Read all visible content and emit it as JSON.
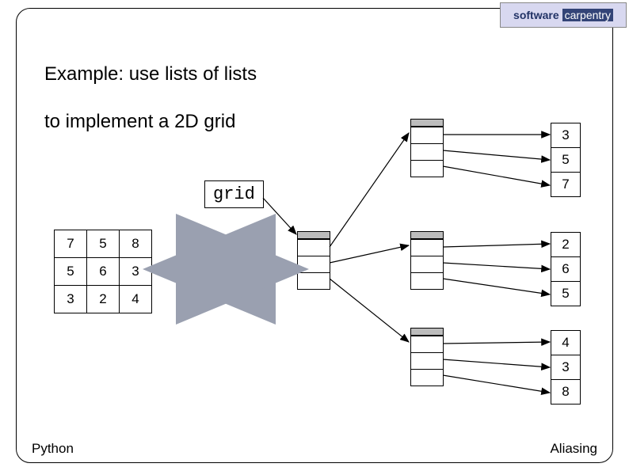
{
  "logo": {
    "word1": "software",
    "word2": "carpentry"
  },
  "heading": {
    "line1": "Example: use lists of lists",
    "line2": "to implement a 2D grid"
  },
  "grid_label": "grid",
  "matrix": [
    [
      "7",
      "5",
      "8"
    ],
    [
      "5",
      "6",
      "3"
    ],
    [
      "3",
      "2",
      "4"
    ]
  ],
  "list1_values": [
    "3",
    "5",
    "7"
  ],
  "list2_values": [
    "2",
    "6",
    "5"
  ],
  "list3_values": [
    "4",
    "3",
    "8"
  ],
  "footer": {
    "left": "Python",
    "right": "Aliasing"
  },
  "chart_data": {
    "type": "diagram",
    "title": "lists of lists implementing a 2D grid",
    "grid_matrix": [
      [
        7,
        5,
        8
      ],
      [
        5,
        6,
        3
      ],
      [
        3,
        2,
        4
      ]
    ],
    "outer_list_length": 3,
    "inner_lists": [
      {
        "index": 0,
        "values": [
          3,
          5,
          7
        ]
      },
      {
        "index": 1,
        "values": [
          2,
          6,
          5
        ]
      },
      {
        "index": 2,
        "values": [
          4,
          3,
          8
        ]
      }
    ]
  }
}
